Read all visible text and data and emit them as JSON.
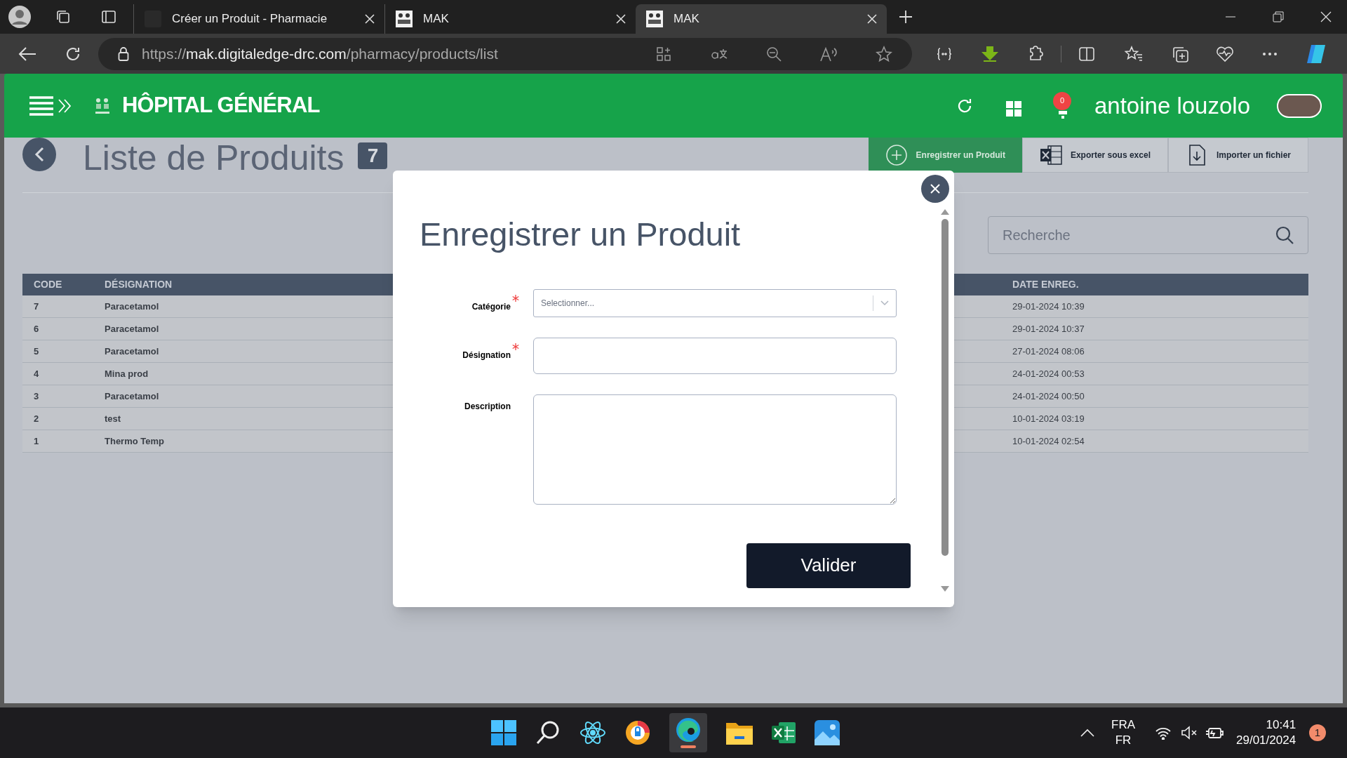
{
  "browser": {
    "tabs": [
      {
        "title": "Créer un Produit - Pharmacie",
        "selected": false
      },
      {
        "title": "MAK",
        "selected": false
      },
      {
        "title": "MAK",
        "selected": true
      }
    ],
    "url": {
      "scheme": "https://",
      "host": "mak.digitaledge-drc.com",
      "path": "/pharmacy/products/list"
    }
  },
  "header": {
    "title": "HÔPITAL GÉNÉRAL",
    "notifications": "0",
    "user": "antoine louzolo"
  },
  "page": {
    "title": "Liste de Produits",
    "count": "7",
    "actions": [
      {
        "label": "Enregistrer un Produit",
        "kind": "add"
      },
      {
        "label": "Exporter sous excel",
        "kind": "excel"
      },
      {
        "label": "Importer un fichier",
        "kind": "import"
      }
    ],
    "search": {
      "placeholder": "Recherche"
    }
  },
  "table": {
    "columns": [
      "CODE",
      "DÉSIGNATION",
      "DATE ENREG."
    ],
    "rows": [
      {
        "code": "7",
        "designation": "Paracetamol",
        "date": "29-01-2024 10:39"
      },
      {
        "code": "6",
        "designation": "Paracetamol",
        "date": "29-01-2024 10:37"
      },
      {
        "code": "5",
        "designation": "Paracetamol",
        "date": "27-01-2024 08:06"
      },
      {
        "code": "4",
        "designation": "Mina prod",
        "date": "24-01-2024 00:53"
      },
      {
        "code": "3",
        "designation": "Paracetamol",
        "date": "24-01-2024 00:50"
      },
      {
        "code": "2",
        "designation": "test",
        "date": "10-01-2024 03:19"
      },
      {
        "code": "1",
        "designation": "Thermo Temp",
        "date": "10-01-2024 02:54"
      }
    ]
  },
  "modal": {
    "title": "Enregistrer un Produit",
    "fields": [
      {
        "label": "Catégorie",
        "required": true,
        "kind": "select",
        "placeholder": "Selectionner..."
      },
      {
        "label": "Désignation",
        "required": true,
        "kind": "input"
      },
      {
        "label": "Description",
        "required": false,
        "kind": "textarea"
      }
    ],
    "submit": "Valider"
  },
  "taskbar": {
    "language": "FRA",
    "layout": "FR",
    "time": "10:41",
    "date": "29/01/2024",
    "notifications": "1"
  }
}
